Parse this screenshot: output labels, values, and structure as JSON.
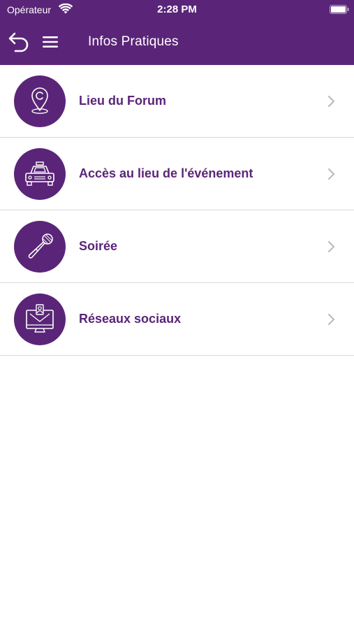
{
  "status_bar": {
    "carrier": "Opérateur",
    "time": "2:28 PM"
  },
  "nav": {
    "title": "Infos Pratiques",
    "back_icon": "back-arrow-icon",
    "menu_icon": "hamburger-menu-icon"
  },
  "items": [
    {
      "label": "Lieu du Forum",
      "icon": "map-pin-icon"
    },
    {
      "label": "Accès au lieu de l'événement",
      "icon": "taxi-icon"
    },
    {
      "label": "Soirée",
      "icon": "microphone-icon"
    },
    {
      "label": "Réseaux sociaux",
      "icon": "computer-network-icon"
    }
  ],
  "colors": {
    "brand": "#5a2578",
    "separator": "#d8d8d8",
    "chevron": "#b8b8bd"
  }
}
